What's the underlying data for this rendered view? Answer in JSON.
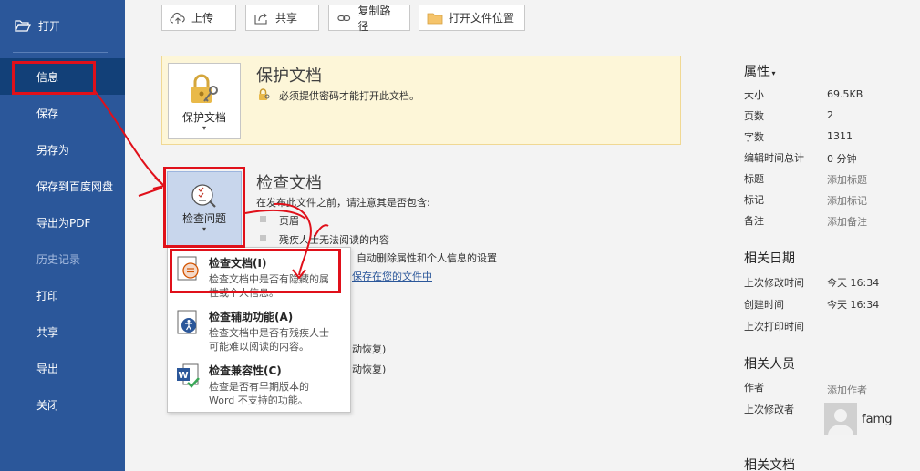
{
  "sidebar": {
    "open_label": "打开",
    "items": [
      {
        "label": "信息"
      },
      {
        "label": "保存"
      },
      {
        "label": "另存为"
      },
      {
        "label": "保存到百度网盘"
      },
      {
        "label": "导出为PDF"
      },
      {
        "label": "历史记录"
      },
      {
        "label": "打印"
      },
      {
        "label": "共享"
      },
      {
        "label": "导出"
      },
      {
        "label": "关闭"
      }
    ]
  },
  "toolbar": {
    "upload": "上传",
    "share": "共享",
    "copy_path": "复制路径",
    "open_location": "打开文件位置"
  },
  "protect": {
    "button_label": "保护文档",
    "title": "保护文档",
    "desc": "必须提供密码才能打开此文档。"
  },
  "inspect": {
    "button_label": "检查问题",
    "title": "检查文档",
    "intro": "在发布此文件之前，请注意其是否包含:",
    "bullets": [
      "页眉",
      "残疾人士无法阅读的内容"
    ],
    "line_auto": "自动删除属性和个人信息的设置",
    "link_partial": "保存在您的文件中",
    "recover_1": "动恢复)",
    "recover_2": "动恢复)"
  },
  "menu": {
    "items": [
      {
        "title": "检查文档(I)",
        "desc": "检查文档中是否有隐藏的属性或个人信息。"
      },
      {
        "title": "检查辅助功能(A)",
        "desc": "检查文档中是否有残疾人士可能难以阅读的内容。"
      },
      {
        "title": "检查兼容性(C)",
        "desc": "检查是否有早期版本的 Word 不支持的功能。"
      }
    ]
  },
  "properties": {
    "header": "属性",
    "rows": [
      {
        "label": "大小",
        "value": "69.5KB"
      },
      {
        "label": "页数",
        "value": "2"
      },
      {
        "label": "字数",
        "value": "1311"
      },
      {
        "label": "编辑时间总计",
        "value": "0 分钟"
      },
      {
        "label": "标题",
        "value": "添加标题"
      },
      {
        "label": "标记",
        "value": "添加标记"
      },
      {
        "label": "备注",
        "value": "添加备注"
      }
    ],
    "dates_header": "相关日期",
    "dates": [
      {
        "label": "上次修改时间",
        "value": "今天 16:34"
      },
      {
        "label": "创建时间",
        "value": "今天 16:34"
      },
      {
        "label": "上次打印时间",
        "value": ""
      }
    ],
    "people_header": "相关人员",
    "author_label": "作者",
    "author_value": "添加作者",
    "last_modified_by_label": "上次修改者",
    "last_modified_by_name": "famg",
    "docs_header": "相关文档"
  },
  "colors": {
    "sidebar_bg": "#2b579a",
    "sidebar_active": "#124078",
    "annotation_red": "#e0101a",
    "protect_bg": "#fdf6d8"
  }
}
